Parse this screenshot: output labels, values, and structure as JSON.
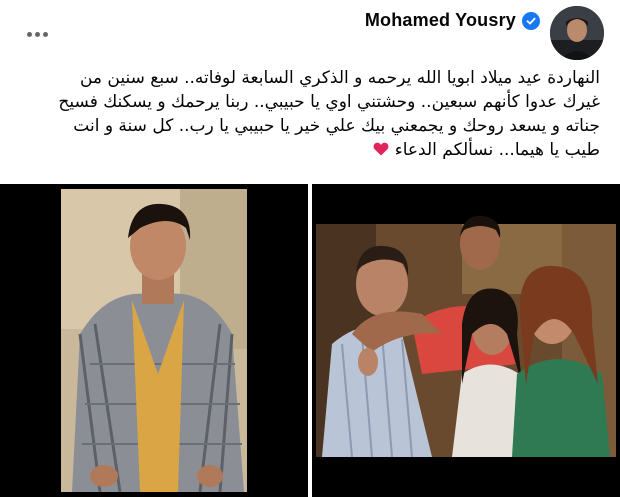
{
  "post": {
    "author_name": "Mohamed Yousry",
    "text_lines": [
      "النهاردة عيد ميلاد ابويا الله يرحمه و الذكري السابعة لوفاته.. سبع سنين من",
      "غيرك عدوا كأنهم سبعين.. وحشتني اوي يا حبيبي.. ربنا يرحمك و يسكنك فسيح",
      "جناته و يسعد روحك و يجمعني بيك علي خير يا حبيبي يا رب..  كل سنة و انت",
      "طيب يا هيما... نسألكم الدعاء"
    ]
  },
  "icons": {
    "more": "more-horizontal-icon",
    "verified": "verified-check-icon",
    "heart": "red-heart-emoji"
  },
  "colors": {
    "verified_blue": "#1877f2",
    "heart_red": "#e0245e",
    "muted_gray": "#65676b"
  }
}
